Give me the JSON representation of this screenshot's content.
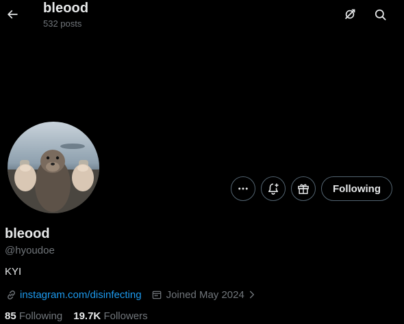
{
  "header": {
    "title": "bleood",
    "post_count": "532 posts",
    "back_icon": "arrow-left-icon",
    "grok_icon": "grok-icon",
    "search_icon": "search-icon"
  },
  "profile": {
    "avatar_image": "sea lion holding two cans",
    "display_name": "bleood",
    "handle": "@hyoudoe",
    "bio": "KYI",
    "website": "instagram.com/disinfecting",
    "joined": "Joined May 2024",
    "following_count": "85",
    "following_label": "Following",
    "followers_count": "19.7K",
    "followers_label": "Followers"
  },
  "actions": {
    "more_icon": "more-dots-icon",
    "notify_icon": "bell-plus-icon",
    "gift_icon": "gift-icon",
    "follow_label": "Following"
  },
  "colors": {
    "background": "#000000",
    "text": "#e7e9ea",
    "secondary_text": "#71767b",
    "link": "#1d9bf0",
    "border": "#536471"
  }
}
